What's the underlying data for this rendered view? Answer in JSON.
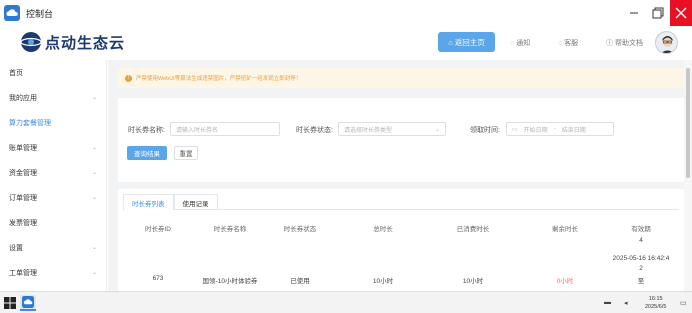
{
  "window": {
    "title": "控制台"
  },
  "header": {
    "brand": "点动生态云",
    "home_button": "返回主页",
    "nav": [
      {
        "label": "通知",
        "icon": "bell-icon"
      },
      {
        "label": "客服",
        "icon": "headset-icon"
      },
      {
        "label": "帮助文档",
        "icon": "help-icon"
      }
    ]
  },
  "sidebar": {
    "items": [
      {
        "label": "首页",
        "chevron": false,
        "active": false
      },
      {
        "label": "我的应用",
        "chevron": true,
        "active": false
      },
      {
        "label": "算力套餐管理",
        "chevron": false,
        "active": true
      },
      {
        "label": "账单管理",
        "chevron": true,
        "active": false
      },
      {
        "label": "资金管理",
        "chevron": true,
        "active": false
      },
      {
        "label": "订单管理",
        "chevron": true,
        "active": false
      },
      {
        "label": "发票管理",
        "chevron": false,
        "active": false
      },
      {
        "label": "设置",
        "chevron": true,
        "active": false
      },
      {
        "label": "工单管理",
        "chevron": true,
        "active": false
      }
    ]
  },
  "notice": "严禁使用WebUI等算法生成违禁图片，严禁挖矿一经发现立即封停！",
  "filters": {
    "name_label": "时长券名称:",
    "name_placeholder": "请输入时长券名",
    "status_label": "时长券状态:",
    "status_placeholder": "请选择时长券类型",
    "time_label": "领取时间:",
    "start_placeholder": "开始日期",
    "range_sep": "-",
    "end_placeholder": "结束日期",
    "search_button": "查询结果",
    "reset_button": "重置"
  },
  "tabs": [
    "时长券列表",
    "使用记录"
  ],
  "table": {
    "columns": [
      "时长券ID",
      "时长券名称",
      "时长券状态",
      "总时长",
      "已消费时长",
      "剩余时长",
      "有效期"
    ],
    "header_extra": "4",
    "validity_lines": [
      "2025-05-16 16:42:4",
      "2",
      "至"
    ],
    "rows": [
      {
        "id": "673",
        "name": "国领-10小时体验券",
        "status": "已使用",
        "total": "10小时",
        "used": "10小时",
        "remaining": "0小时"
      }
    ]
  },
  "taskbar": {
    "time": "16:15",
    "date": "2025/6/5"
  },
  "colors": {
    "accent": "#5aa6e8",
    "active_text": "#3f8ae0",
    "danger": "#f56c6c",
    "warning": "#e6a23c"
  }
}
